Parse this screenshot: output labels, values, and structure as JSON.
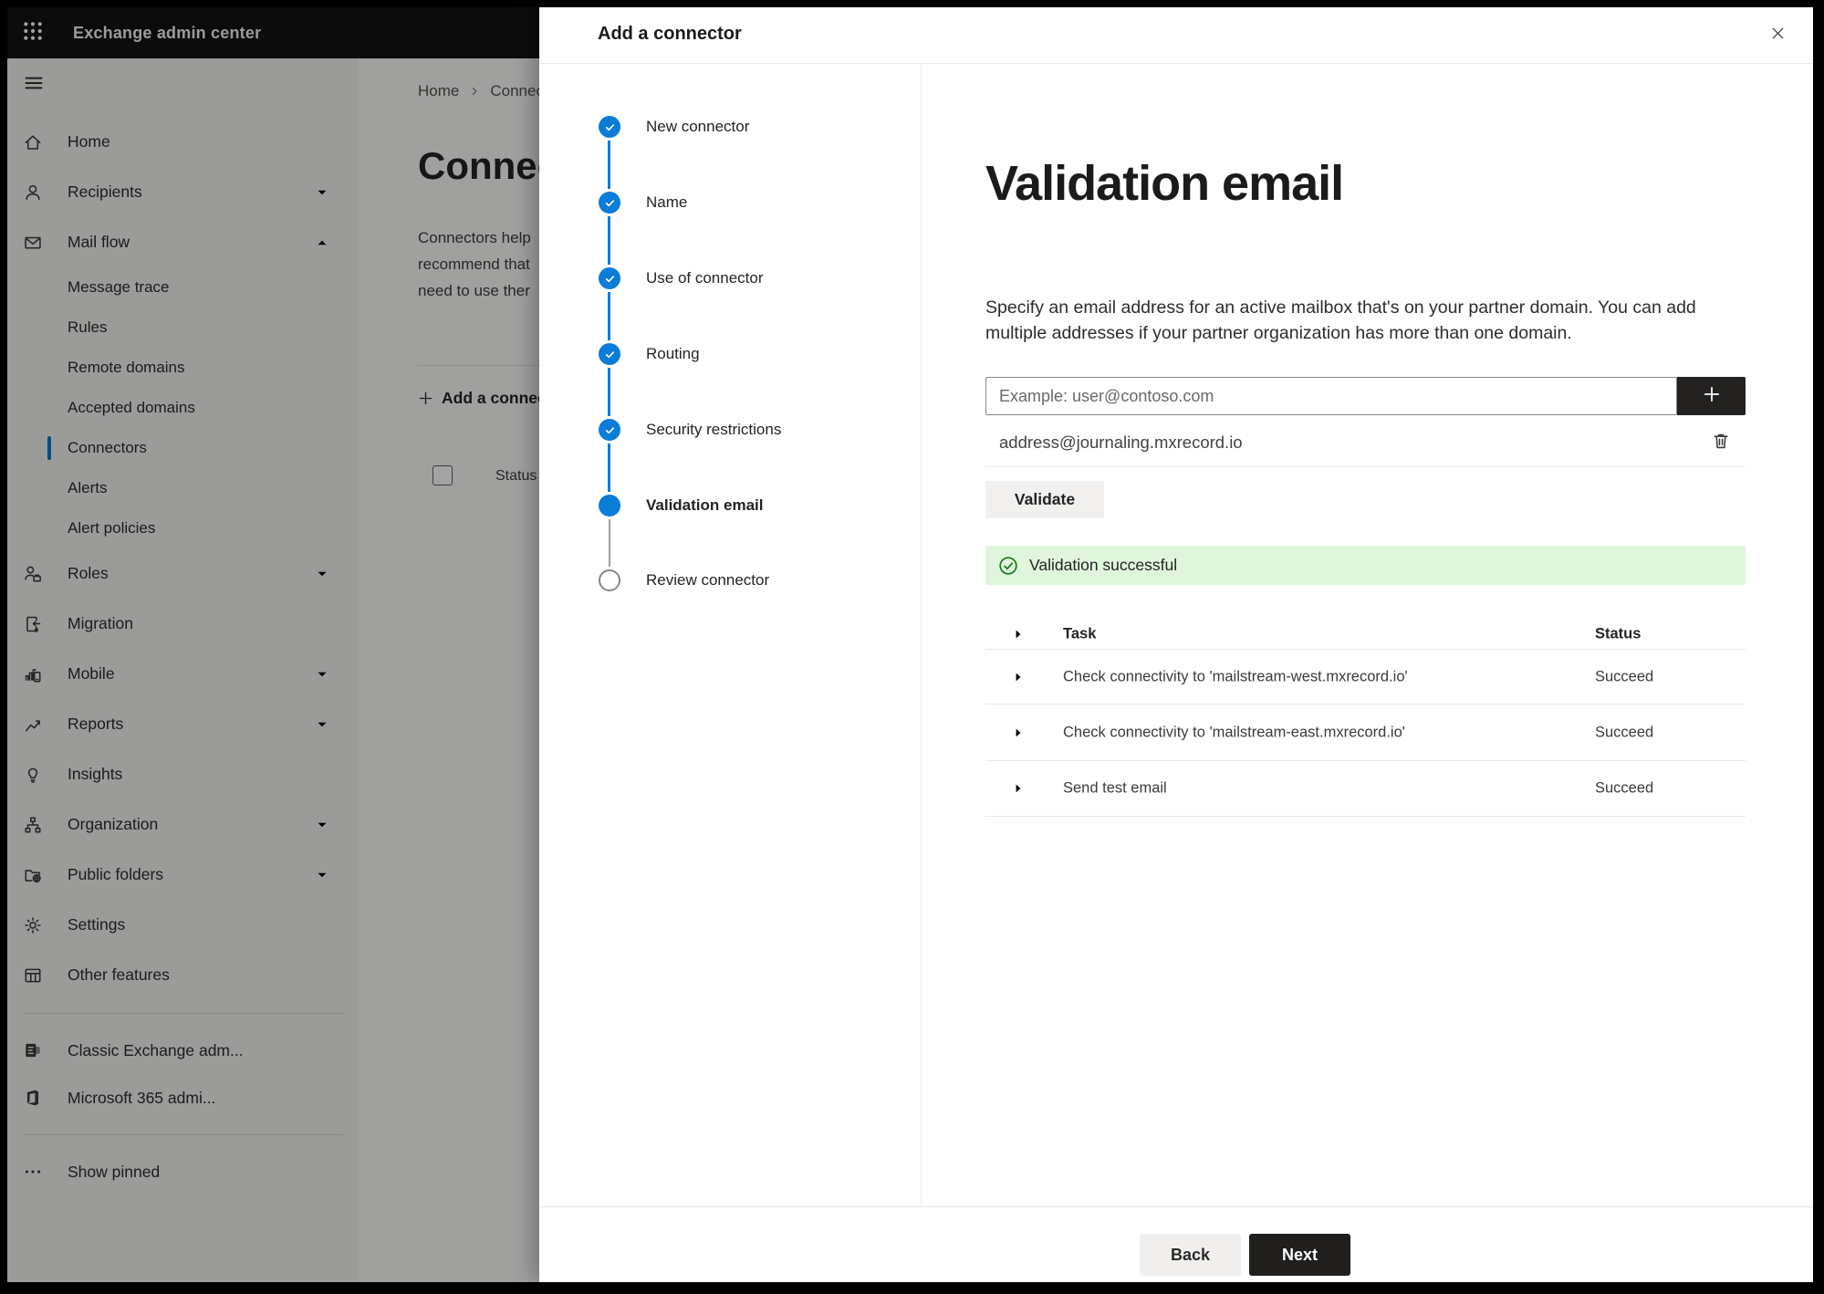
{
  "chrome": {
    "app_title": "Exchange admin center"
  },
  "sidebar": {
    "items": [
      {
        "label": "Home"
      },
      {
        "label": "Recipients",
        "expandable": "down"
      },
      {
        "label": "Mail flow",
        "expandable": "up",
        "expanded": true
      },
      {
        "label": "Message trace"
      },
      {
        "label": "Rules"
      },
      {
        "label": "Remote domains"
      },
      {
        "label": "Accepted domains"
      },
      {
        "label": "Connectors",
        "selected": true
      },
      {
        "label": "Alerts"
      },
      {
        "label": "Alert policies"
      },
      {
        "label": "Roles",
        "expandable": "down"
      },
      {
        "label": "Migration"
      },
      {
        "label": "Mobile",
        "expandable": "down"
      },
      {
        "label": "Reports",
        "expandable": "down"
      },
      {
        "label": "Insights"
      },
      {
        "label": "Organization",
        "expandable": "down"
      },
      {
        "label": "Public folders",
        "expandable": "down"
      },
      {
        "label": "Settings"
      },
      {
        "label": "Other features"
      },
      {
        "label": "Classic Exchange adm..."
      },
      {
        "label": "Microsoft 365 admi..."
      },
      {
        "label": "Show pinned"
      }
    ]
  },
  "page": {
    "breadcrumb": {
      "home": "Home",
      "current": "Connectors"
    },
    "title": "Connectors",
    "intro_line1": "Connectors help",
    "intro_line2": "recommend that",
    "intro_line3": "need to use ther",
    "add_connector_button": "Add a connector",
    "list_header_status": "Status"
  },
  "panel": {
    "title": "Add a connector",
    "steps": [
      {
        "label": "New connector",
        "state": "completed"
      },
      {
        "label": "Name",
        "state": "completed"
      },
      {
        "label": "Use of connector",
        "state": "completed"
      },
      {
        "label": "Routing",
        "state": "completed"
      },
      {
        "label": "Security restrictions",
        "state": "completed"
      },
      {
        "label": "Validation email",
        "state": "current"
      },
      {
        "label": "Review connector",
        "state": "upcoming"
      }
    ],
    "heading": "Validation email",
    "description_line1": "Specify an email address for an active mailbox that's on your partner domain. You can add",
    "description_line2": "multiple addresses if your partner organization has more than one domain.",
    "email_placeholder": "Example: user@contoso.com",
    "email_value": "",
    "added_address": "address@journaling.mxrecord.io",
    "validate_button": "Validate",
    "success_banner": "Validation successful",
    "table": {
      "task_header": "Task",
      "status_header": "Status",
      "rows": [
        {
          "task": "Check connectivity to 'mailstream-west.mxrecord.io'",
          "status": "Succeed"
        },
        {
          "task": "Check connectivity to 'mailstream-east.mxrecord.io'",
          "status": "Succeed"
        },
        {
          "task": "Send test email",
          "status": "Succeed"
        }
      ]
    },
    "back_button": "Back",
    "next_button": "Next"
  },
  "colors": {
    "accent": "#0078d4",
    "success_bg": "#dff6dd",
    "success_green": "#107c10",
    "topbar": "#131313"
  }
}
